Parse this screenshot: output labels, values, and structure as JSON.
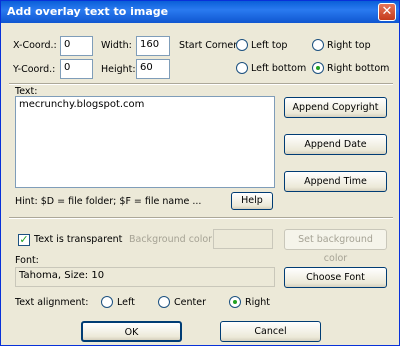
{
  "title": "Add overlay text to image",
  "coords": {
    "x_label": "X-Coord.:",
    "x_value": "0",
    "y_label": "Y-Coord.:",
    "y_value": "0",
    "width_label": "Width:",
    "width_value": "160",
    "height_label": "Height:",
    "height_value": "60"
  },
  "start_corner": {
    "label": "Start Corner:",
    "options": [
      "Left top",
      "Right top",
      "Left bottom",
      "Right bottom"
    ],
    "selected": "Right bottom"
  },
  "text_section": {
    "label": "Text:",
    "value": "mecrunchy.blogspot.com",
    "hint": "Hint: $D = file folder; $F = file name ...",
    "help_label": "Help",
    "append_copyright_label": "Append Copyright",
    "append_date_label": "Append Date",
    "append_time_label": "Append Time"
  },
  "transparency": {
    "label": "Text is transparent",
    "checked": true,
    "bg_color_label": "Background color",
    "set_bg_label": "Set background color"
  },
  "font": {
    "label": "Font:",
    "value": "Tahoma, Size: 10",
    "choose_label": "Choose Font"
  },
  "alignment": {
    "label": "Text alignment:",
    "options": [
      "Left",
      "Center",
      "Right"
    ],
    "selected": "Right"
  },
  "buttons": {
    "ok_label": "OK",
    "cancel_label": "Cancel"
  },
  "colors": {
    "titlebar": "#0a5fd8",
    "dialog_bg": "#ece9d8",
    "radio_selected": "#21a121"
  }
}
